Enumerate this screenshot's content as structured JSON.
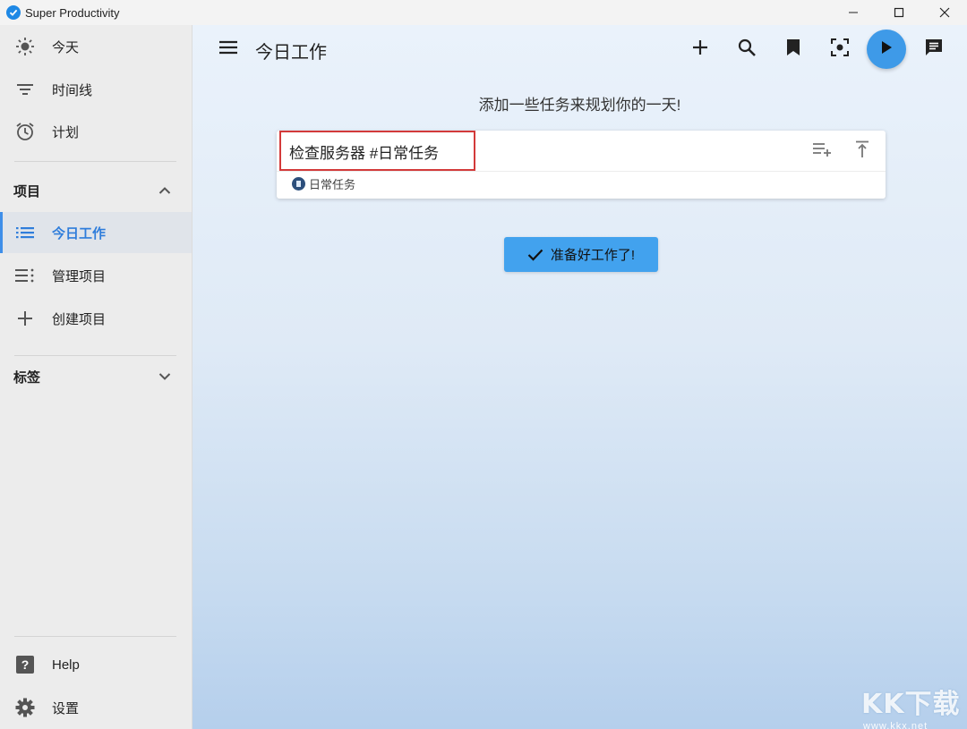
{
  "window": {
    "title": "Super Productivity"
  },
  "sidebar": {
    "nav": [
      {
        "label": "今天",
        "icon": "sun-icon"
      },
      {
        "label": "时间线",
        "icon": "filter-list-icon"
      },
      {
        "label": "计划",
        "icon": "alarm-clock-icon"
      }
    ],
    "projects_header": "项目",
    "projects": [
      {
        "label": "今日工作",
        "icon": "list-icon",
        "active": true
      },
      {
        "label": "管理项目",
        "icon": "manage-list-icon"
      },
      {
        "label": "创建项目",
        "icon": "plus-icon"
      }
    ],
    "tags_header": "标签",
    "footer": [
      {
        "label": "Help",
        "icon": "help-icon"
      },
      {
        "label": "设置",
        "icon": "gear-icon"
      }
    ]
  },
  "header": {
    "title": "今日工作",
    "actions": [
      "add-icon",
      "search-icon",
      "bookmark-icon",
      "focus-icon",
      "play-icon",
      "chat-icon"
    ]
  },
  "main": {
    "headline": "添加一些任务来规划你的一天!",
    "task_input_value": "检查服务器 #日常任务",
    "tag_label": "日常任务",
    "ready_button": "准备好工作了!"
  },
  "watermark": {
    "text": "KK下载",
    "url": "www.kkx.net"
  },
  "colors": {
    "accent": "#3e9ae8",
    "active_text": "#2f7ddb",
    "highlight_border": "#d33a3a"
  }
}
